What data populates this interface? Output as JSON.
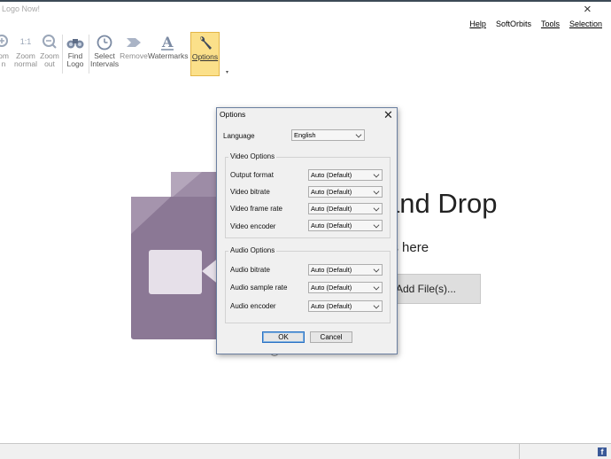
{
  "app": {
    "title": "Logo Now!"
  },
  "menu": [
    {
      "label": "Help",
      "underline": true
    },
    {
      "label": "SoftOrbits",
      "underline": false
    },
    {
      "label": "Tools",
      "underline": true
    },
    {
      "label": "Selection",
      "underline": true
    }
  ],
  "toolbar": {
    "zoom_in": [
      "om",
      "n"
    ],
    "zoom_normal": [
      "1:1",
      "Zoom",
      "normal"
    ],
    "zoom_out": [
      "Zoom",
      "out"
    ],
    "find_logo": [
      "Find",
      "Logo"
    ],
    "select_intervals": [
      "Select",
      "Intervals"
    ],
    "remove": "Remove",
    "watermarks": "Watermarks",
    "options": "Options"
  },
  "main": {
    "drop_title": "and Drop",
    "drop_subtitle": "os here",
    "add_files": "Add File(s)..."
  },
  "dialog": {
    "title": "Options",
    "language_label": "Language",
    "language_value": "English",
    "video_group": "Video Options",
    "video_rows": [
      {
        "label": "Output format",
        "value": "Auto (Default)"
      },
      {
        "label": "Video bitrate",
        "value": "Auto (Default)"
      },
      {
        "label": "Video frame rate",
        "value": "Auto (Default)"
      },
      {
        "label": "Video encoder",
        "value": "Auto (Default)"
      }
    ],
    "audio_group": "Audio Options",
    "audio_rows": [
      {
        "label": "Audio bitrate",
        "value": "Auto (Default)"
      },
      {
        "label": "Audio sample rate",
        "value": "Auto (Default)"
      },
      {
        "label": "Audio encoder",
        "value": "Auto (Default)"
      }
    ],
    "ok": "OK",
    "cancel": "Cancel"
  },
  "colors": {
    "accent_active": "#fbe08a",
    "video_icon": "#8b7895",
    "facebook": "#3b5998"
  }
}
